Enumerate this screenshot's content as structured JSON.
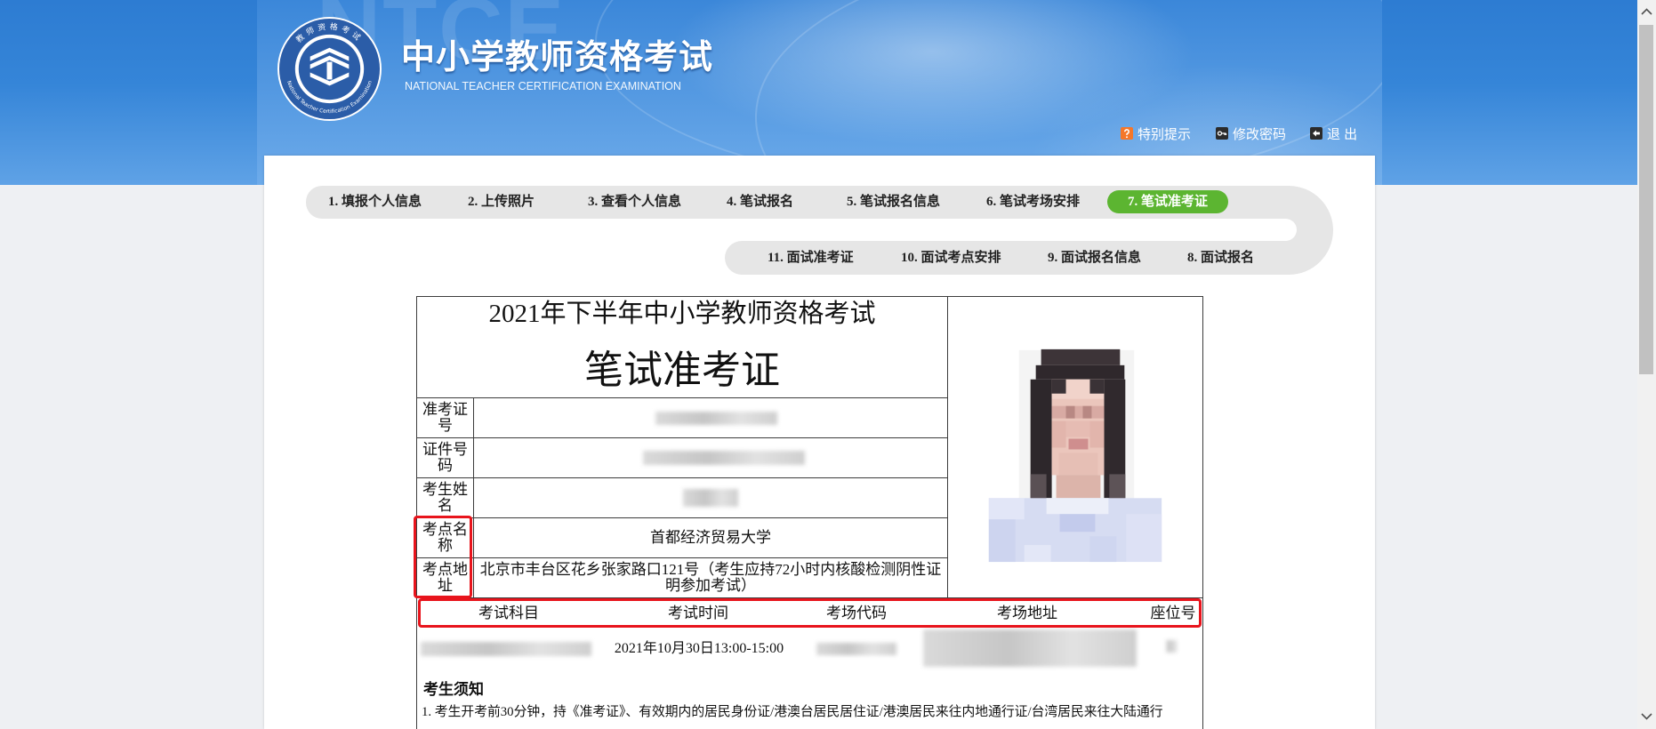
{
  "colors": {
    "header_blue": "#3585d8",
    "active_step": "#5cb531",
    "step_track": "#e6e6e6",
    "highlight_red": "#e8141c",
    "page_background": "#eef0f3",
    "panel_background": "#ffffff"
  },
  "header": {
    "watermark": "NTCE",
    "logo": {
      "ring_top": "教师资格考试",
      "ring_bottom": "National Teacher Certification Examination"
    },
    "title": "中小学教师资格考试",
    "subtitle": "NATIONAL TEACHER CERTIFICATION EXAMINATION",
    "links": [
      {
        "label": "特别提示",
        "icon": "notice-icon"
      },
      {
        "label": "修改密码",
        "icon": "key-icon"
      },
      {
        "label": "退 出",
        "icon": "logout-icon"
      }
    ]
  },
  "steps": {
    "top_row": [
      "1. 填报个人信息",
      "2. 上传照片",
      "3. 查看个人信息",
      "4. 笔试报名",
      "5. 笔试报名信息",
      "6. 笔试考场安排",
      "7. 笔试准考证"
    ],
    "bottom_row": [
      "11. 面试准考证",
      "10. 面试考点安排",
      "9. 面试报名信息",
      "8. 面试报名"
    ],
    "active_index": 6
  },
  "ticket": {
    "exam_title": "2021年下半年中小学教师资格考试",
    "doc_title": "笔试准考证",
    "fields": [
      {
        "label": "准考证号",
        "redacted": true
      },
      {
        "label": "证件号码",
        "redacted": true
      },
      {
        "label": "考生姓名",
        "redacted": true
      },
      {
        "label": "考点名称",
        "value": "首都经济贸易大学"
      },
      {
        "label": "考点地址",
        "value": "北京市丰台区花乡张家路口121号（考生应持72小时内核酸检测阴性证明参加考试）"
      }
    ],
    "schedule": {
      "columns": [
        "考试科目",
        "考试时间",
        "考场代码",
        "考场地址",
        "座位号"
      ],
      "rows": [
        {
          "subject_redacted": true,
          "time": "2021年10月30日13:00-15:00",
          "room_code_redacted": true,
          "room_address_redacted": true,
          "seat_redacted": true
        }
      ]
    },
    "notice": {
      "heading": "考生须知",
      "items": [
        "1. 考生开考前30分钟，持《准考证》、有效期内的居民身份证/港澳台居民居住证/港澳居民来往内地通行证/台湾居民来往大陆通行"
      ]
    }
  }
}
